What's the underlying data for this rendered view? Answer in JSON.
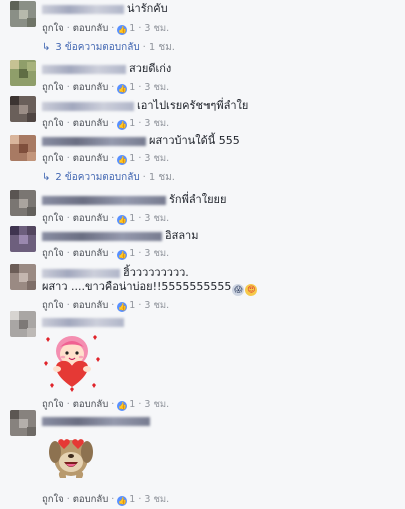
{
  "actions": {
    "like": "ถูกใจ",
    "reply": "ตอบกลับ",
    "dot": "·"
  },
  "comments": [
    {
      "text": "น่ารักคับ",
      "likes": "1",
      "time": "3 ชม."
    },
    {
      "text": "สวยดีเก่ง",
      "likes": "1",
      "time": "3 ชม."
    },
    {
      "text": "เอาไปเรยครัช๚ๆพี่ลำใย",
      "likes": "1",
      "time": "3 ชม."
    },
    {
      "text": "ผสาวบ้านใด้นี้ 555",
      "likes": "1",
      "time": "3 ชม."
    },
    {
      "text": "รักพี่ลำใยยย",
      "likes": "1",
      "time": "3 ชม."
    },
    {
      "text": "อิสลาม",
      "likes": "1",
      "time": "3 ชม."
    },
    {
      "text": "ฮิ้ววววววววว.",
      "text2": "ผสาว ....ขาวคือน่าบ่อย!!5555555555",
      "likes": "1",
      "time": "3 ชม."
    },
    {
      "likes": "1",
      "time": "3 ชม."
    },
    {
      "likes": "1",
      "time": "3 ชม."
    }
  ],
  "reply_links": [
    {
      "label": "3 ข้อความตอบกลับ",
      "time": "1 ชม."
    },
    {
      "label": "2 ข้อความตอบกลับ",
      "time": "1 ชม."
    }
  ],
  "icons": {
    "like": "thumbs-up-icon",
    "reply_arrow": "reply-arrow-icon"
  },
  "colors": {
    "link": "#4267b2",
    "meta": "#90949c",
    "like_badge": "#5890ff"
  }
}
